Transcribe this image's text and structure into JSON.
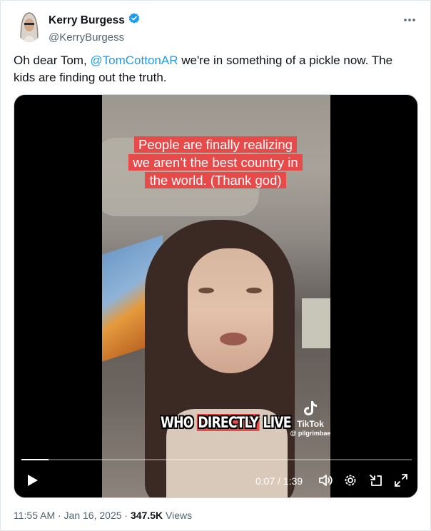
{
  "author": {
    "name": "Kerry Burgess",
    "handle": "@KerryBurgess",
    "verified_icon": "verified-badge-icon"
  },
  "tweet": {
    "text_before": "Oh dear Tom, ",
    "mention": "@TomCottonAR",
    "text_after": "  we're in something of a pickle now. The kids are finding out the truth."
  },
  "video": {
    "caption_lines": [
      "People are finally realizing",
      "we aren’t the best country in",
      "the world. (Thank god)"
    ],
    "subtitle_pre": "WHO ",
    "subtitle_highlight": "DIRECTLY",
    "subtitle_post": " LIVE",
    "watermark_brand": "TikTok",
    "watermark_user": "@ pilgrimbae",
    "time_display": "0:07 / 1:39",
    "progress": 0.07,
    "icons": [
      "play-icon",
      "volume-icon",
      "settings-icon",
      "exit-fullscreen-icon",
      "fullscreen-icon"
    ]
  },
  "meta": {
    "timestamp": "11:55 AM · Jan 16, 2025 · ",
    "views_count": "347.5K",
    "views_label": " Views"
  },
  "colors": {
    "accent": "#1d9bf0",
    "caption_bg": "#e84a4a",
    "text_secondary": "#536471"
  }
}
